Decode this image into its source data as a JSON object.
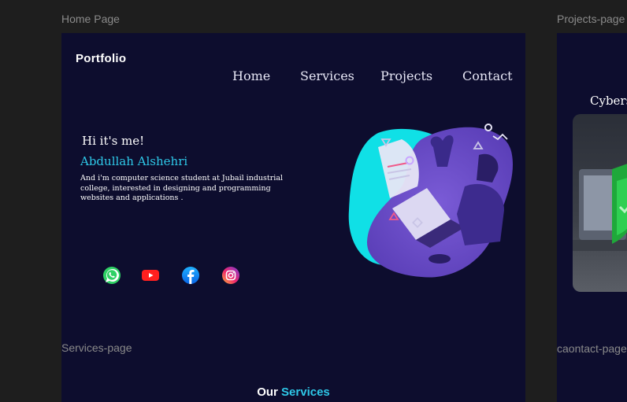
{
  "frames": {
    "home_label": "Home Page",
    "projects_label": "Projects-page",
    "services_label": "Services-page",
    "contact_label": "caontact-page"
  },
  "home": {
    "logo": "Portfolio",
    "nav": [
      "Home",
      "Services",
      "Projects",
      "Contact"
    ],
    "greeting": "Hi it's me!",
    "name": "Abdullah Alshehri",
    "description": "And i'm computer science student at Jubail industrial college, interested in designing and  programming websites and applications .",
    "social_icons": [
      "whatsapp-icon",
      "youtube-icon",
      "facebook-icon",
      "instagram-icon"
    ],
    "accent_color": "#2ec8e8",
    "background_color": "#0d0d2e"
  },
  "projects": {
    "title": "Cybers"
  },
  "services": {
    "title_word1": "Our",
    "title_word2": "Services"
  }
}
